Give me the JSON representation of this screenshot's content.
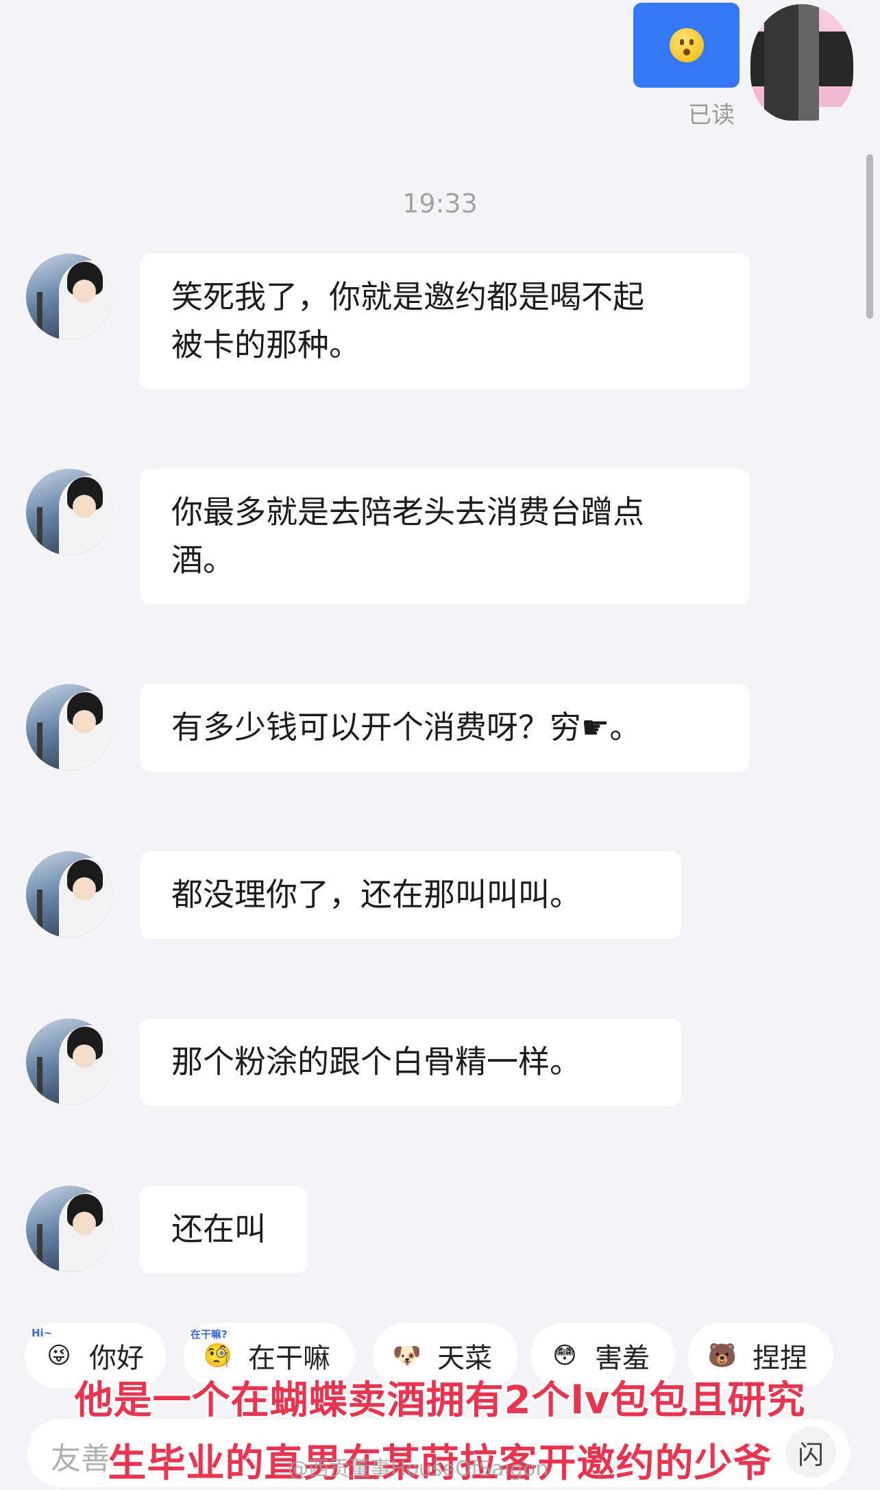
{
  "chat": {
    "sent_emoji_icon": "worried-face-emoji",
    "read_status": "已读",
    "timestamp": "19:33",
    "messages": [
      {
        "line1": "笑死我了，你就是邀约都是喝不起",
        "line2": "被卡的那种。"
      },
      {
        "line1": "你最多就是去陪老头去消费台蹭点",
        "line2": "酒。"
      },
      {
        "line1": "有多少钱可以开个消费呀？穷☛。"
      },
      {
        "line1": "都没理你了，还在那叫叫叫。"
      },
      {
        "line1": "那个粉涂的跟个白骨精一样。"
      },
      {
        "line1": "还在叫"
      }
    ]
  },
  "quick_replies": [
    {
      "label": "你好",
      "icon": "😜",
      "tag": "Hi~"
    },
    {
      "label": "在干嘛",
      "icon": "🧐",
      "tag": "在干嘛?"
    },
    {
      "label": "天菜",
      "icon": "🐶",
      "tag": ""
    },
    {
      "label": "害羞",
      "icon": "😳",
      "tag": ""
    },
    {
      "label": "捏捏",
      "icon": "🐻",
      "tag": ""
    }
  ],
  "input": {
    "placeholder": "友善",
    "flash_label": "闪"
  },
  "caption": {
    "line1": "他是一个在蝴蝶卖酒拥有2个lv包包且研究",
    "line2": "生毕业的直男在某莳拉客开邀约的少爷"
  },
  "watermark": "@西贡董事HouseOfSaigon",
  "colors": {
    "accent": "#3478f6",
    "caption": "#e8344f",
    "background": "#f4f4f6"
  }
}
